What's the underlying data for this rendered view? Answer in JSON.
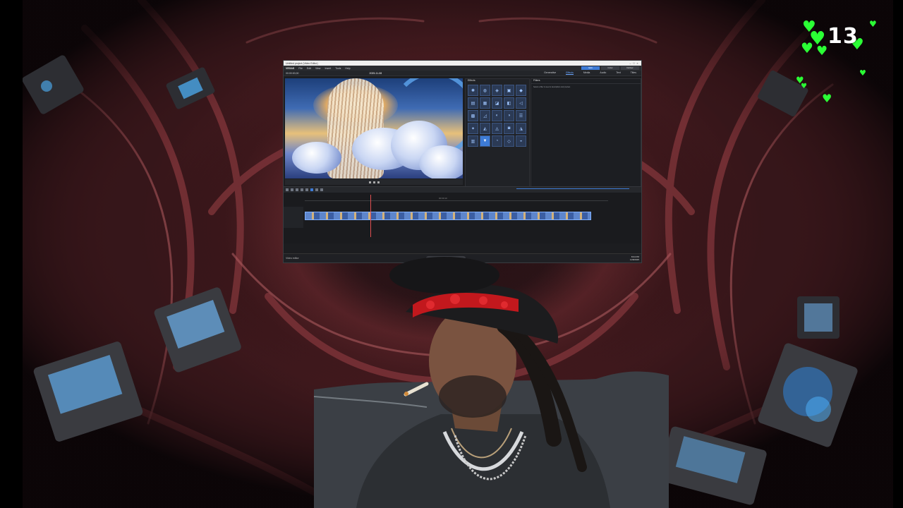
{
  "stream": {
    "counter_value": "13",
    "counter_icon": "heart-icon",
    "accent_color": "#2bff35"
  },
  "editor": {
    "window_title": "Untitled project (Video Editor)",
    "menu": {
      "logo": "VEGAS",
      "items": [
        "File",
        "Edit",
        "View",
        "Insert",
        "Tools",
        "Help"
      ],
      "right_tabs": [
        "Edit",
        "Color",
        "Deliver"
      ],
      "active_tab": "Edit"
    },
    "panel_tabs": [
      "Generative",
      "Effects",
      "Media",
      "Audio",
      "Text",
      "Titles"
    ],
    "active_panel_tab": "Effects",
    "project_date": "2025-11-08",
    "timecode": "00:00:00;00",
    "effects_panel": {
      "header": "Effects",
      "selected_index": 21
    },
    "info_panel": {
      "header": "Filters",
      "description": "Select a filter to see its description and preview."
    },
    "timeline": {
      "ruler_mark": "00:00:10"
    },
    "taskbar": {
      "left_label": "Video editor",
      "search_placeholder": "Search",
      "time": "8:04 PM",
      "date": "11/8/2025"
    }
  }
}
